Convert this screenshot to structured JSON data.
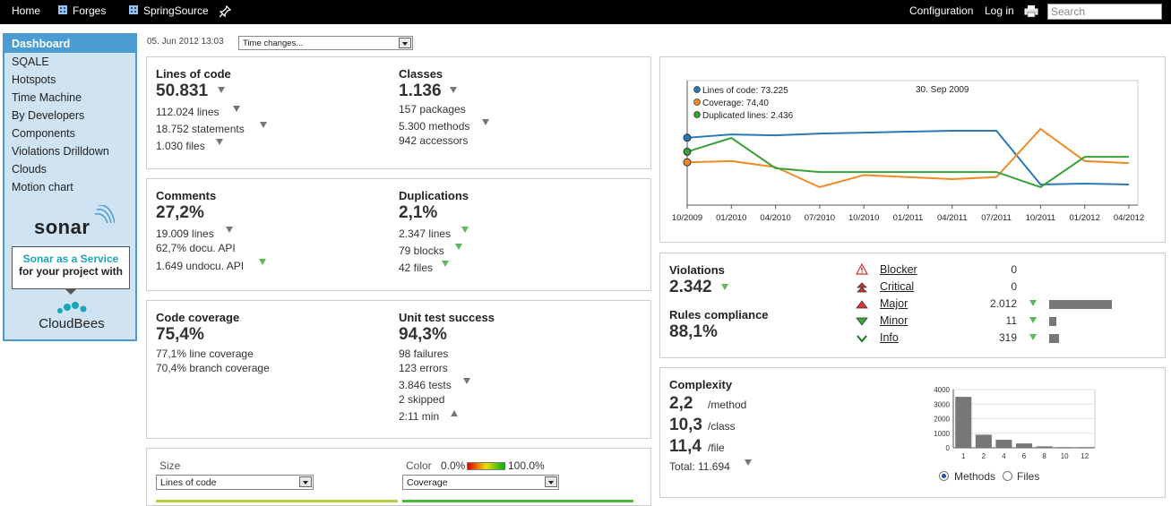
{
  "topbar": {
    "home": "Home",
    "forges": "Forges",
    "project": "SpringSource",
    "configuration": "Configuration",
    "login": "Log in",
    "search_placeholder": "Search"
  },
  "sidebar": {
    "items": [
      {
        "label": "Dashboard"
      },
      {
        "label": "SQALE"
      },
      {
        "label": "Hotspots"
      },
      {
        "label": "Time Machine"
      },
      {
        "label": "By Developers"
      },
      {
        "label": "Components"
      },
      {
        "label": "Violations Drilldown"
      },
      {
        "label": "Clouds"
      },
      {
        "label": "Motion chart"
      }
    ],
    "sonar_logo": "sonar",
    "saas_line1": "Sonar as a Service",
    "saas_line2": "for your project with",
    "cloudbees": "CloudBees"
  },
  "datebar": {
    "date": "05. Jun 2012 13:03",
    "time_changes": "Time changes..."
  },
  "size_widget": {
    "loc_title": "Lines of code",
    "loc_value": "50.831",
    "loc_lines": "112.024 lines",
    "loc_statements": "18.752 statements",
    "loc_files": "1.030 files",
    "classes_title": "Classes",
    "classes_value": "1.136",
    "classes_packages": "157 packages",
    "classes_methods": "5.300 methods",
    "classes_accessors": "942 accessors"
  },
  "comments_widget": {
    "comments_title": "Comments",
    "comments_value": "27,2%",
    "comments_lines": "19.009 lines",
    "docu_api": "62,7% docu. API",
    "undocu_api": "1.649 undocu. API",
    "dup_title": "Duplications",
    "dup_value": "2,1%",
    "dup_lines": "2.347 lines",
    "dup_blocks": "79 blocks",
    "dup_files": "42 files"
  },
  "coverage_widget": {
    "cov_title": "Code coverage",
    "cov_value": "75,4%",
    "line_cov": "77,1% line coverage",
    "branch_cov": "70,4% branch coverage",
    "ut_title": "Unit test success",
    "ut_value": "94,3%",
    "failures": "98 failures",
    "errors": "123 errors",
    "tests": "3.846 tests",
    "skipped": "2 skipped",
    "duration": "2:11 min"
  },
  "treemap_widget": {
    "size_label": "Size",
    "size_value": "Lines of code",
    "color_label": "Color",
    "color_min": "0.0%",
    "color_max": "100.0%",
    "color_value": "Coverage"
  },
  "timeline": {
    "legend_loc": "Lines of code: 73.225",
    "legend_cov": "Coverage: 74,40",
    "legend_dup": "Duplicated lines: 2.436",
    "date": "30. Sep 2009",
    "x_ticks": [
      "10/2009",
      "01/2010",
      "04/2010",
      "07/2010",
      "10/2010",
      "01/2011",
      "04/2011",
      "07/2011",
      "10/2011",
      "01/2012",
      "04/2012"
    ],
    "colors": {
      "loc": "#2a78b6",
      "coverage": "#f08a24",
      "duplicated": "#3aa13a"
    }
  },
  "violations_widget": {
    "title": "Violations",
    "value": "2.342",
    "rules_title": "Rules compliance",
    "rules_value": "88,1%",
    "rows": [
      {
        "label": "Blocker",
        "count": "0",
        "ratio": 0
      },
      {
        "label": "Critical",
        "count": "0",
        "ratio": 0
      },
      {
        "label": "Major",
        "count": "2.012",
        "ratio": 1.0
      },
      {
        "label": "Minor",
        "count": "11",
        "ratio": 0.005
      },
      {
        "label": "Info",
        "count": "319",
        "ratio": 0.16
      }
    ]
  },
  "complexity_widget": {
    "title": "Complexity",
    "per_method_value": "2,2",
    "per_method_unit": "/method",
    "per_class_value": "10,3",
    "per_class_unit": "/class",
    "per_file_value": "11,4",
    "per_file_unit": "/file",
    "total": "Total: 11.694",
    "radio_methods": "Methods",
    "radio_files": "Files"
  },
  "chart_data": [
    {
      "type": "line",
      "title": "",
      "x": [
        "10/2009",
        "01/2010",
        "04/2010",
        "07/2010",
        "10/2010",
        "01/2011",
        "04/2011",
        "07/2011",
        "10/2011",
        "01/2012",
        "04/2012"
      ],
      "series": [
        {
          "name": "Lines of code",
          "values": [
            73225,
            75000,
            74500,
            75500,
            76000,
            76500,
            77000,
            77000,
            48000,
            48500,
            48000
          ]
        },
        {
          "name": "Coverage",
          "values": [
            74.4,
            75,
            72,
            62,
            68,
            67,
            66,
            67,
            91,
            75,
            74
          ]
        },
        {
          "name": "Duplicated lines",
          "values": [
            2436,
            2800,
            2000,
            1900,
            1900,
            1900,
            1900,
            1900,
            1500,
            2300,
            2300
          ]
        }
      ],
      "grid": true,
      "legend": "top-left"
    },
    {
      "type": "bar",
      "categories": [
        "1",
        "2",
        "4",
        "6",
        "8",
        "10",
        "12"
      ],
      "values": [
        3500,
        900,
        550,
        300,
        100,
        50,
        50
      ],
      "ylim": [
        0,
        4000
      ],
      "yticks": [
        "0",
        "1000",
        "2000",
        "3000",
        "4000"
      ],
      "grid": true
    }
  ]
}
